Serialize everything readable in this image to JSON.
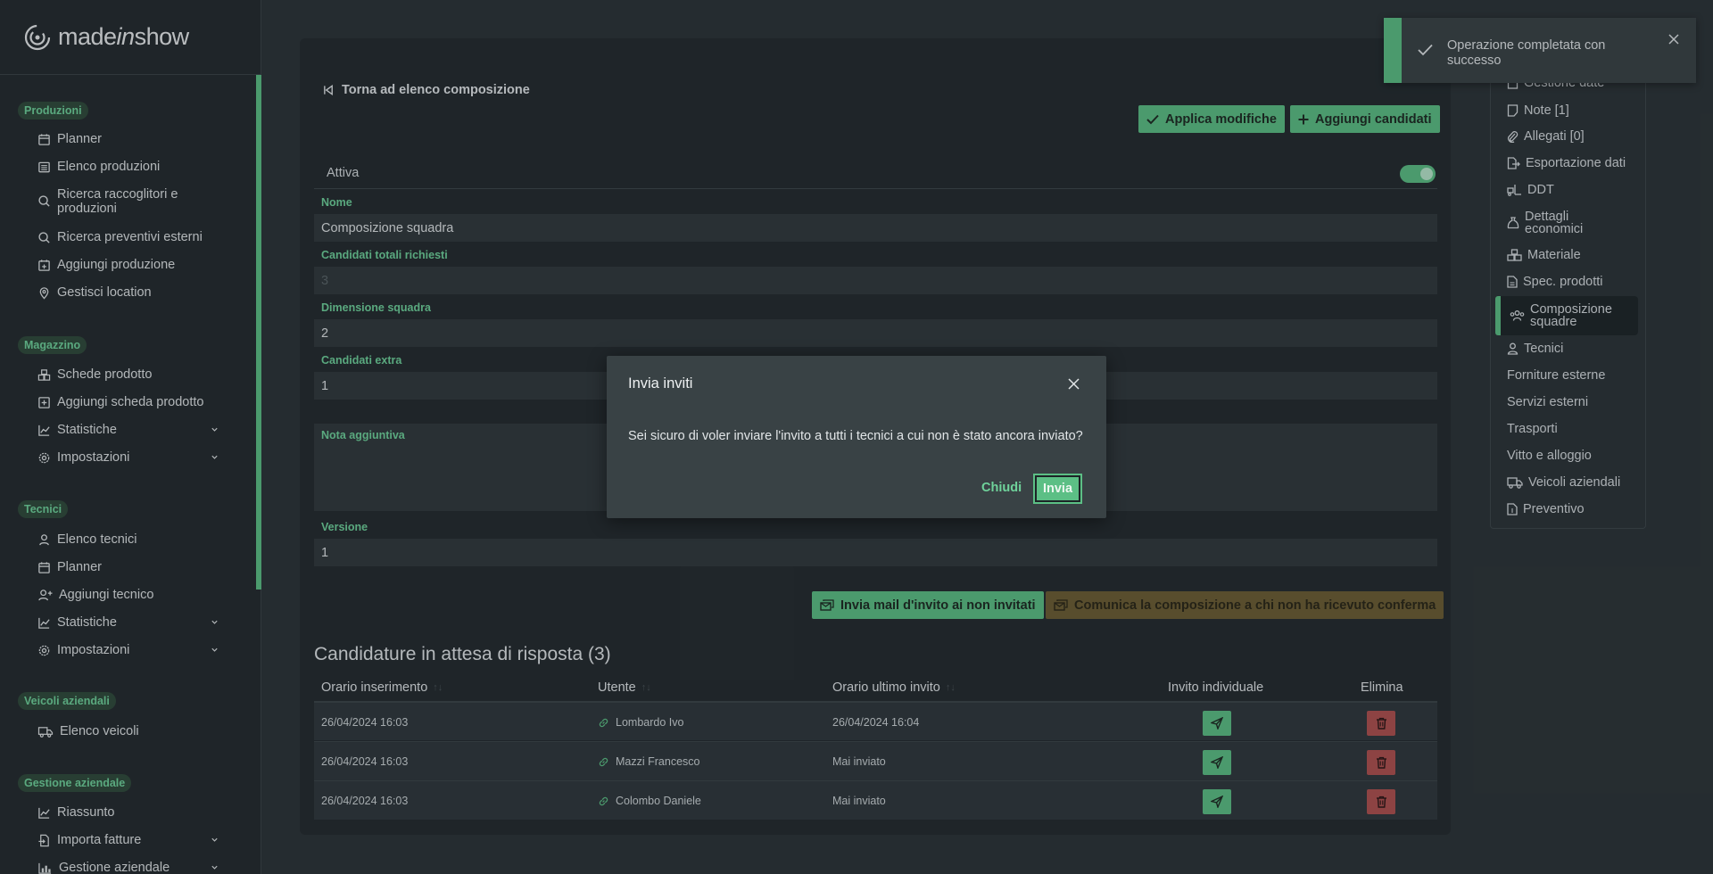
{
  "brand": {
    "name_prefix": "made",
    "name_italic": "in",
    "name_suffix": "show"
  },
  "sidebar": {
    "sections": [
      {
        "title": "Produzioni",
        "items": [
          "Planner",
          "Elenco produzioni",
          "Ricerca raccoglitori e produzioni",
          "Ricerca preventivi esterni",
          "Aggiungi produzione",
          "Gestisci location"
        ]
      },
      {
        "title": "Magazzino",
        "items": [
          "Schede prodotto",
          "Aggiungi scheda prodotto",
          "Statistiche",
          "Impostazioni"
        ]
      },
      {
        "title": "Tecnici",
        "items": [
          "Elenco tecnici",
          "Planner",
          "Aggiungi tecnico",
          "Statistiche",
          "Impostazioni"
        ]
      },
      {
        "title": "Veicoli aziendali",
        "items": [
          "Elenco veicoli"
        ]
      },
      {
        "title": "Gestione aziendale",
        "items": [
          "Riassunto",
          "Importa fatture",
          "Gestione aziendale"
        ]
      }
    ]
  },
  "main": {
    "back_label": "Torna ad elenco composizione",
    "apply_label": "Applica modifiche",
    "add_candidates_label": "Aggiungi candidati",
    "active_label": "Attiva",
    "active_value": true,
    "fields": {
      "nome_label": "Nome",
      "nome_value": "Composizione squadra",
      "totali_label": "Candidati totali richiesti",
      "totali_value": "3",
      "dimensione_label": "Dimensione squadra",
      "dimensione_value": "2",
      "extra_label": "Candidati extra",
      "extra_value": "1",
      "nota_label": "Nota aggiuntiva",
      "nota_value": "",
      "versione_label": "Versione",
      "versione_value": "1"
    },
    "invite_label": "Invia mail d'invito ai non invitati",
    "communicate_label": "Comunica la composizione a chi non ha ricevuto conferma",
    "section_title": "Candidature in attesa di risposta (3)",
    "table": {
      "headers": [
        "Orario inserimento",
        "Utente",
        "Orario ultimo invito",
        "Invito individuale",
        "Elimina"
      ],
      "sort_glyph": "↑↓",
      "rows": [
        {
          "inserted": "26/04/2024 16:03",
          "user": "Lombardo Ivo",
          "last_invite": "26/04/2024 16:04"
        },
        {
          "inserted": "26/04/2024 16:03",
          "user": "Mazzi Francesco",
          "last_invite": "Mai inviato"
        },
        {
          "inserted": "26/04/2024 16:03",
          "user": "Colombo Daniele",
          "last_invite": "Mai inviato"
        }
      ]
    }
  },
  "right_nav": {
    "items": [
      "Gestione date",
      "Note [1]",
      "Allegati [0]",
      "Esportazione dati",
      "DDT",
      "Dettagli economici",
      "Materiale",
      "Spec. prodotti",
      "Composizione squadre",
      "Tecnici",
      "Forniture esterne",
      "Servizi esterni",
      "Trasporti",
      "Vitto e alloggio",
      "Veicoli aziendali",
      "Preventivo"
    ],
    "active": "Composizione squadre"
  },
  "toast": {
    "text": "Operazione completata con successo"
  },
  "modal": {
    "title": "Invia inviti",
    "body": "Sei sicuro di voler inviare l'invito a tutti i tecnici a cui non è stato ancora inviato?",
    "cancel_label": "Chiudi",
    "confirm_label": "Invia"
  },
  "colors": {
    "accent": "#5cbf85",
    "danger": "#b0504f",
    "warning": "#6c5d32",
    "background": "#2b3236"
  }
}
